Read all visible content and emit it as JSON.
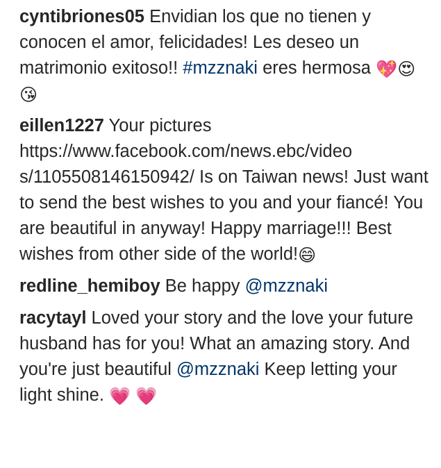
{
  "comments": [
    {
      "username": "cyntibriones05",
      "text_1": "Envidian los que no tienen y conocen el amor, felicidades! Les deseo un matrimonio exitoso!!",
      "hashtag": "#mzznaki",
      "text_2": "eres hermosa",
      "emojis": [
        "💖",
        "😍",
        "😘"
      ]
    },
    {
      "username": "eillen1227",
      "text_1": "Your pictures https://www.facebook.com/news.ebc/video s/1105508146150942/ Is on Taiwan news! Just want to send the best wishes to you and your fiancé! You are beautiful in anyway! Happy marriage!!! Best wishes from other side of the world!",
      "emojis": [
        "😄"
      ]
    },
    {
      "username": "redline_hemiboy",
      "text_1": "Be happy",
      "mention": "@mzznaki"
    },
    {
      "username": "racytayl",
      "text_1": "Loved your story and the love your future husband has for you! What an amazing story. And you're just beautiful",
      "mention": "@mzznaki",
      "text_2": "Keep letting your light shine.",
      "emojis": [
        "💗",
        "💗"
      ]
    }
  ],
  "colors": {
    "text": "#262626",
    "link": "#003569",
    "background": "#ffffff"
  }
}
